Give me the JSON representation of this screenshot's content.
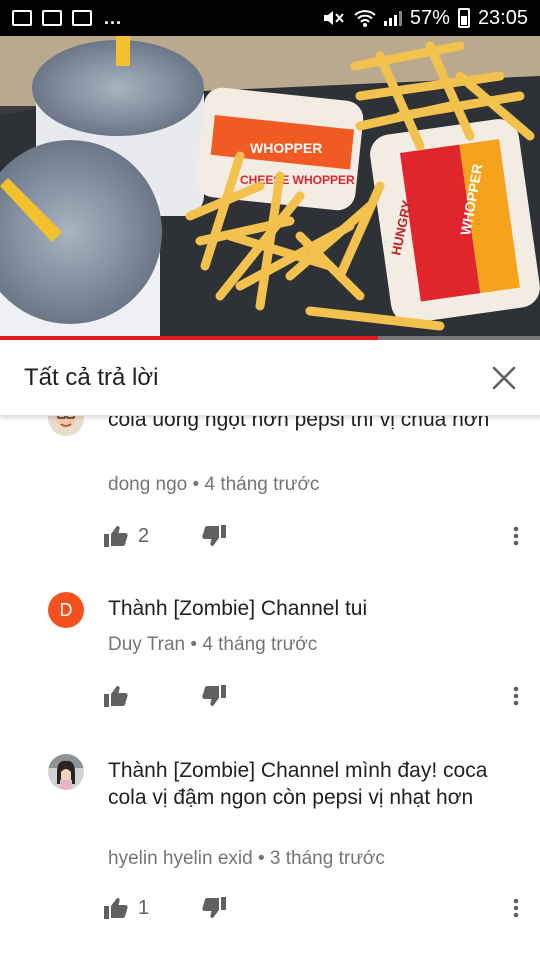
{
  "status_bar": {
    "overflow": "...",
    "battery": "57%",
    "time": "23:05"
  },
  "video": {
    "wrapper_labels": [
      "WHOPPER",
      "WHOPPER",
      "CHEESE WHOPPER",
      "HUNGRY"
    ],
    "progress_fraction": 0.7
  },
  "replies_panel": {
    "title": "Tất cả trả lời"
  },
  "comments": [
    {
      "text": "cola uống ngọt hơn pepsi thì vị chua hơn",
      "author": "dong ngo",
      "time": "4 tháng trước",
      "likes": "2"
    },
    {
      "avatar_letter": "D",
      "text": "Thành [Zombie] Channel tui",
      "author": "Duy Tran",
      "time": "4 tháng trước",
      "likes": ""
    },
    {
      "text": "Thành [Zombie] Channel mình đay! coca cola vị đậm ngon còn pepsi vị nhạt hơn",
      "author": "hyelin hyelin exid",
      "time": "3 tháng trước",
      "likes": "1"
    }
  ],
  "colors": {
    "accent_red": "#e01b1b",
    "avatar_orange": "#f4511e",
    "text_primary": "#212121",
    "text_secondary": "#757575"
  },
  "icons": {
    "like": "thumbs-up-icon",
    "dislike": "thumbs-down-icon",
    "more": "more-vert-icon",
    "close": "close-icon"
  }
}
